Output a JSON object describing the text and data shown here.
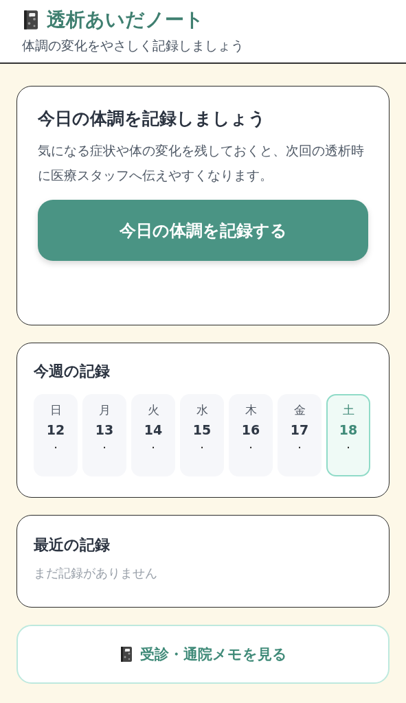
{
  "header": {
    "title": "透析あいだノート",
    "subtitle": "体調の変化をやさしく記録しましょう"
  },
  "intro_card": {
    "title": "今日の体調を記録しましょう",
    "body": "気になる症状や体の変化を残しておくと、次回の透析時に医療スタッフへ伝えやすくなります。",
    "button": "今日の体調を記録する"
  },
  "week_card": {
    "title": "今週の記録",
    "days": [
      {
        "weekday": "日",
        "date": "12",
        "mark": "·",
        "selected": false
      },
      {
        "weekday": "月",
        "date": "13",
        "mark": "·",
        "selected": false
      },
      {
        "weekday": "火",
        "date": "14",
        "mark": "·",
        "selected": false
      },
      {
        "weekday": "水",
        "date": "15",
        "mark": "·",
        "selected": false
      },
      {
        "weekday": "木",
        "date": "16",
        "mark": "·",
        "selected": false
      },
      {
        "weekday": "金",
        "date": "17",
        "mark": "·",
        "selected": false
      },
      {
        "weekday": "土",
        "date": "18",
        "mark": "·",
        "selected": true
      }
    ]
  },
  "recent_card": {
    "title": "最近の記録",
    "empty_text": "まだ記録がありません"
  },
  "memo_button": "受診・通院メモを見る"
}
